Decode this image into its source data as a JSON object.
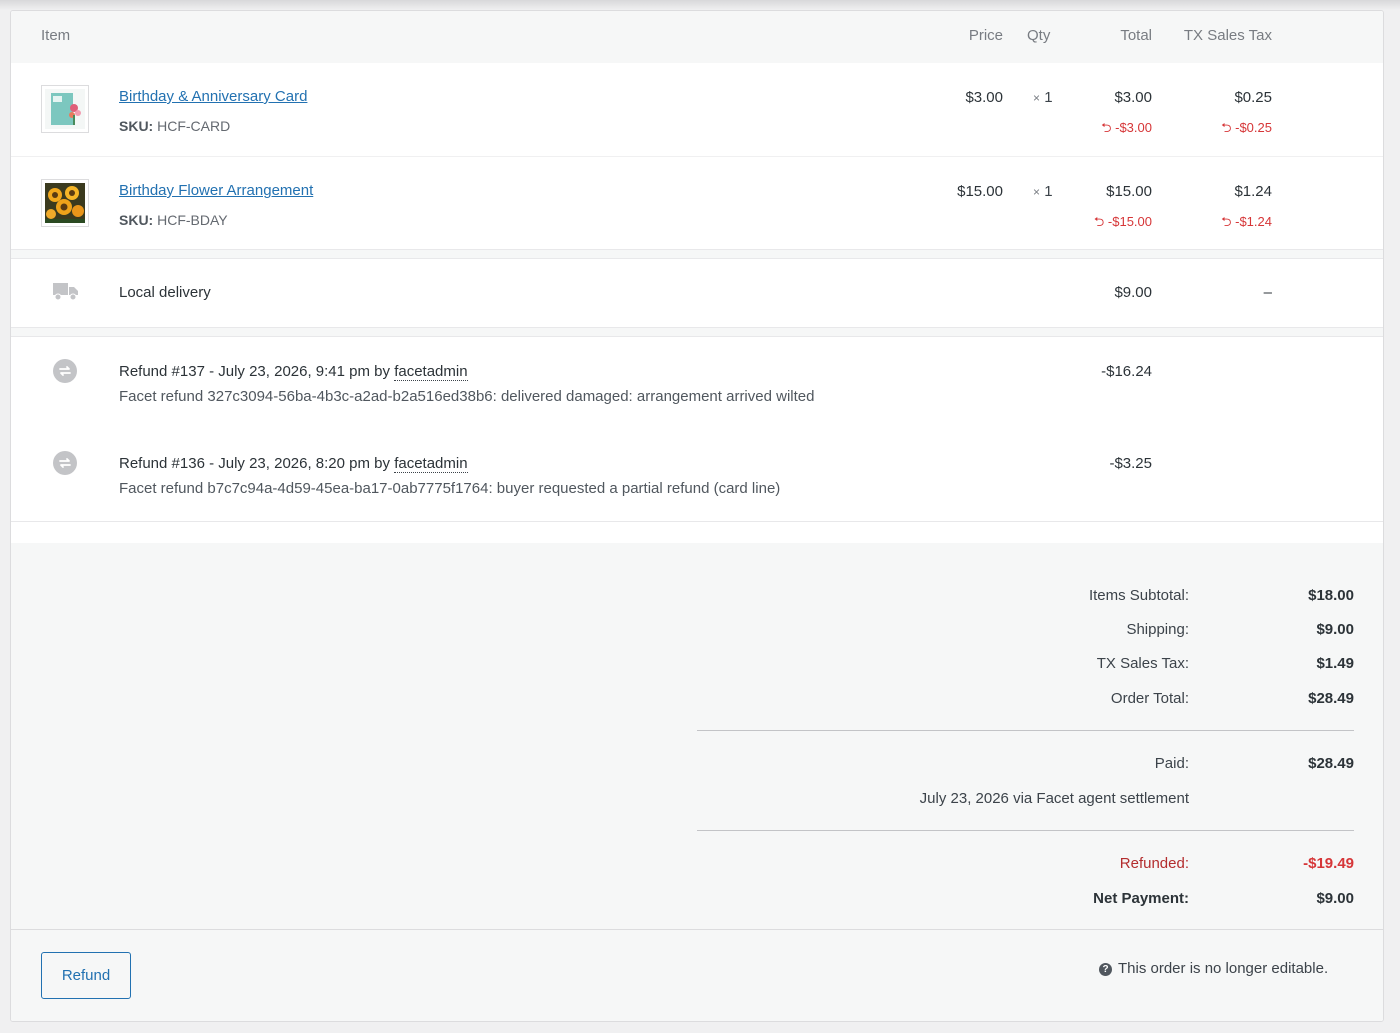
{
  "header": {
    "item": "Item",
    "price": "Price",
    "qty": "Qty",
    "total": "Total",
    "tax": "TX Sales Tax"
  },
  "line_items": [
    {
      "name": "Birthday & Anniversary Card",
      "sku_label": "SKU:",
      "sku": "HCF-CARD",
      "price": "$3.00",
      "qty_x": "×",
      "qty": "1",
      "total": "$3.00",
      "total_refund": "-$3.00",
      "tax": "$0.25",
      "tax_refund": "-$0.25",
      "thumb_icon": "greeting-card-thumbnail"
    },
    {
      "name": "Birthday Flower Arrangement",
      "sku_label": "SKU:",
      "sku": "HCF-BDAY",
      "price": "$15.00",
      "qty_x": "×",
      "qty": "1",
      "total": "$15.00",
      "total_refund": "-$15.00",
      "tax": "$1.24",
      "tax_refund": "-$1.24",
      "thumb_icon": "sunflower-arrangement-thumbnail"
    }
  ],
  "shipping": {
    "name": "Local delivery",
    "total": "$9.00",
    "tax": "–",
    "icon": "truck-icon"
  },
  "refunds": [
    {
      "title_prefix": "Refund #137 - July 23, 2026, 9:41 pm by",
      "by": "facetadmin",
      "reason": "Facet refund 327c3094-56ba-4b3c-a2ad-b2a516ed38b6: delivered damaged: arrangement arrived wilted",
      "amount": "-$16.24"
    },
    {
      "title_prefix": "Refund #136 - July 23, 2026, 8:20 pm by",
      "by": "facetadmin",
      "reason": "Facet refund b7c7c94a-4d59-45ea-ba17-0ab7775f1764: buyer requested a partial refund (card line)",
      "amount": "-$3.25"
    }
  ],
  "totals": {
    "items_subtotal_label": "Items Subtotal:",
    "items_subtotal": "$18.00",
    "shipping_label": "Shipping:",
    "shipping": "$9.00",
    "tax_label": "TX Sales Tax:",
    "tax": "$1.49",
    "order_total_label": "Order Total:",
    "order_total": "$28.49",
    "paid_label": "Paid:",
    "paid": "$28.49",
    "paid_note": "July 23, 2026 via Facet agent settlement",
    "refunded_label": "Refunded:",
    "refunded": "-$19.49",
    "net_label": "Net Payment:",
    "net": "$9.00"
  },
  "footer": {
    "refund_button": "Refund",
    "help_glyph": "?",
    "note": "This order is no longer editable."
  },
  "colors": {
    "link": "#2271b1",
    "refund_red": "#d63638",
    "refunded_total_red": "#b32d2e"
  }
}
